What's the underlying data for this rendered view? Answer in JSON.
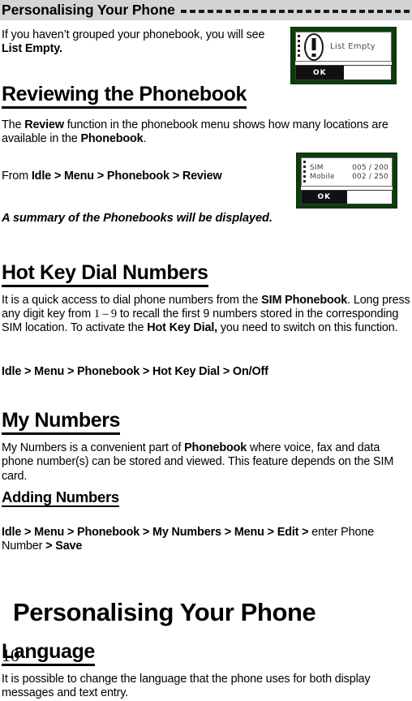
{
  "header": {
    "title": "Personalising Your Phone",
    "rule": "dashed-rule",
    "background_color": "#d4d4d4"
  },
  "intro": {
    "text_before": "If you haven’t grouped your phonebook, you will see ",
    "bold": "List Empty.",
    "full": "If you haven’t grouped your phonebook, you will see List Empty."
  },
  "screenshots": {
    "list_empty": {
      "name": "list-empty-screen",
      "icon": "warning-exclamation-icon",
      "message": "List Empty",
      "softkey_left": "OK",
      "border_color": "#0d3d0d"
    },
    "review_summary": {
      "name": "phonebook-review-screen",
      "rows": [
        {
          "label": "SIM",
          "value": "005 / 200"
        },
        {
          "label": "Mobile",
          "value": "002 / 250"
        }
      ],
      "softkey_left": "OK",
      "border_color": "#0d3d0d"
    }
  },
  "sections": [
    {
      "heading": "Reviewing the Phonebook",
      "paragraph_1_a": "The ",
      "paragraph_1_b": "Review",
      "paragraph_1_c": " function in the phonebook menu shows how many locations are available in the ",
      "paragraph_1_d": "Phonebook",
      "paragraph_1_e": ".",
      "path_prefix": "From ",
      "path": "Idle > Menu > Phonebook > Review",
      "note": "A summary of the Phonebooks will be displayed."
    },
    {
      "heading": "Hot Key Dial Numbers",
      "body_a": "It is a quick access to dial phone numbers from the ",
      "body_b": "SIM Phonebook",
      "body_c": ". Long press any digit key from ",
      "body_d": "1 – 9",
      "body_e": " to recall the first 9 numbers stored in the corresponding SIM location. To activate the ",
      "body_f": "Hot Key Dial,",
      "body_g": " you need to switch on this function.",
      "path": "Idle > Menu > Phonebook > Hot Key Dial > On/Off"
    },
    {
      "heading": "My Numbers",
      "body_a": "My Numbers is a convenient part of ",
      "body_b": "Phonebook",
      "body_c": " where voice, fax and data phone number(s) can be stored and viewed. This feature depends on the SIM card.",
      "subheading": "Adding Numbers",
      "path_a": "Idle > Menu > Phonebook > My Numbers > Menu > Edit > ",
      "path_b": "enter Phone Number",
      "path_c": " > Save"
    }
  ],
  "chapter": {
    "title": "Personalising Your Phone"
  },
  "language_section": {
    "heading": "Language",
    "body": "It is possible to change the language that the phone uses for both display messages and text entry."
  },
  "footer": {
    "page_number": "10"
  }
}
